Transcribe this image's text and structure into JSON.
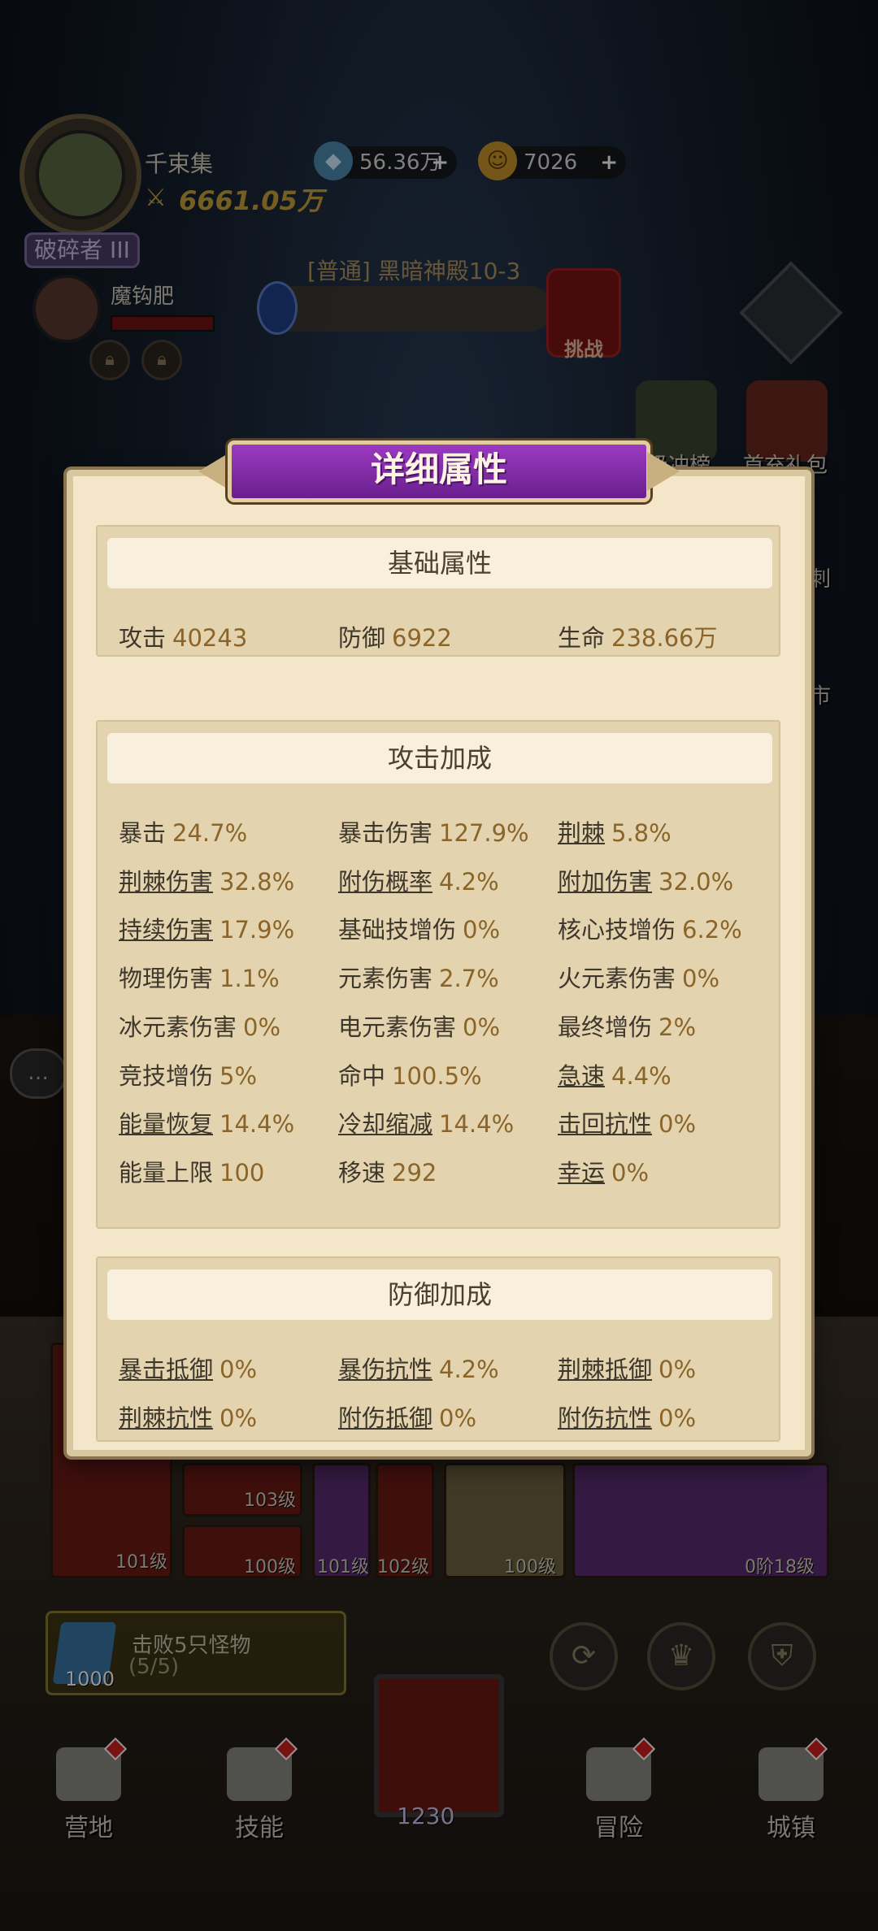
{
  "hud": {
    "player_name": "千束集",
    "power": "6661.05万",
    "rank": "破碎者 III",
    "gems": "56.36万",
    "gold": "7026",
    "plus": "+",
    "boss_name": "魔钩肥",
    "stage_title": "[普通] 黑暗神殿10-3",
    "challenge_label": "挑战",
    "side_buttons": [
      "等级冲榜",
      "首充礼包"
    ],
    "side_partial": [
      "刺",
      "市"
    ]
  },
  "panel": {
    "title": "详细属性",
    "sections": {
      "basic": {
        "title": "基础属性",
        "stats": [
          {
            "label": "攻击",
            "value": "40243",
            "link": false
          },
          {
            "label": "防御",
            "value": "6922",
            "link": false
          },
          {
            "label": "生命",
            "value": "238.66万",
            "link": false
          }
        ]
      },
      "attack": {
        "title": "攻击加成",
        "stats": [
          {
            "label": "暴击",
            "value": "24.7%",
            "link": false
          },
          {
            "label": "暴击伤害",
            "value": "127.9%",
            "link": false
          },
          {
            "label": "荆棘",
            "value": "5.8%",
            "link": true
          },
          {
            "label": "荆棘伤害",
            "value": "32.8%",
            "link": true
          },
          {
            "label": "附伤概率",
            "value": "4.2%",
            "link": true
          },
          {
            "label": "附加伤害",
            "value": "32.0%",
            "link": true
          },
          {
            "label": "持续伤害",
            "value": "17.9%",
            "link": true
          },
          {
            "label": "基础技增伤",
            "value": "0%",
            "link": false
          },
          {
            "label": "核心技增伤",
            "value": "6.2%",
            "link": false
          },
          {
            "label": "物理伤害",
            "value": "1.1%",
            "link": false
          },
          {
            "label": "元素伤害",
            "value": "2.7%",
            "link": false
          },
          {
            "label": "火元素伤害",
            "value": "0%",
            "link": false
          },
          {
            "label": "冰元素伤害",
            "value": "0%",
            "link": false
          },
          {
            "label": "电元素伤害",
            "value": "0%",
            "link": false
          },
          {
            "label": "最终增伤",
            "value": "2%",
            "link": false
          },
          {
            "label": "竞技增伤",
            "value": "5%",
            "link": false
          },
          {
            "label": "命中",
            "value": "100.5%",
            "link": false
          },
          {
            "label": "急速",
            "value": "4.4%",
            "link": true
          },
          {
            "label": "能量恢复",
            "value": "14.4%",
            "link": true
          },
          {
            "label": "冷却缩减",
            "value": "14.4%",
            "link": true
          },
          {
            "label": "击回抗性",
            "value": "0%",
            "link": true
          },
          {
            "label": "能量上限",
            "value": "100",
            "link": false
          },
          {
            "label": "移速",
            "value": "292",
            "link": false
          },
          {
            "label": "幸运",
            "value": "0%",
            "link": true
          }
        ]
      },
      "defense": {
        "title": "防御加成",
        "stats": [
          {
            "label": "暴击抵御",
            "value": "0%",
            "link": true
          },
          {
            "label": "暴伤抗性",
            "value": "4.2%",
            "link": true
          },
          {
            "label": "荆棘抵御",
            "value": "0%",
            "link": true
          },
          {
            "label": "荆棘抗性",
            "value": "0%",
            "link": true
          },
          {
            "label": "附伤抵御",
            "value": "0%",
            "link": true
          },
          {
            "label": "附伤抗性",
            "value": "0%",
            "link": true
          }
        ]
      }
    }
  },
  "equipment": {
    "levels": [
      "101级",
      "103级",
      "100级",
      "101级",
      "102级",
      "100级",
      "0阶18级"
    ]
  },
  "quest": {
    "text": "击败5只怪物",
    "progress": "(5/5)",
    "reward": "1000"
  },
  "nav": {
    "items": [
      "营地",
      "技能",
      "冒险",
      "城镇"
    ],
    "center_count": "1230"
  }
}
